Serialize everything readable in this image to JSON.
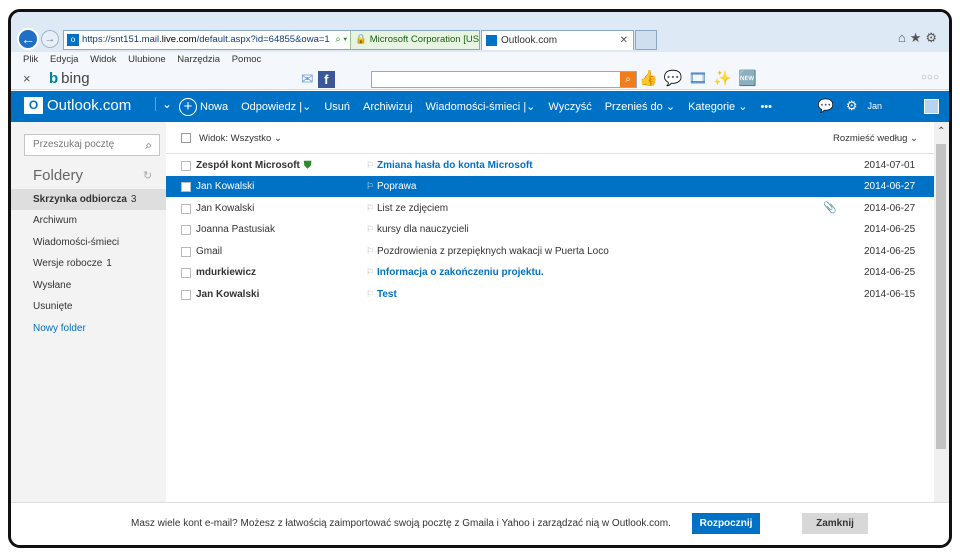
{
  "browser": {
    "url_host": "https://snt151.mail.",
    "url_domain": "live.com",
    "url_path": "/default.aspx?id=64855&owa=1",
    "security": "Microsoft Corporation [US]",
    "tab_title": "Outlook.com",
    "menu": [
      "Plik",
      "Edycja",
      "Widok",
      "Ulubione",
      "Narzędzia",
      "Pomoc"
    ],
    "toolbar_brand": "bing"
  },
  "outlook": {
    "brand": "Outlook.com",
    "commands": {
      "new": "Nowa",
      "reply": "Odpowiedz",
      "delete": "Usuń",
      "archive": "Archiwizuj",
      "junk": "Wiadomości-śmieci",
      "sweep": "Wyczyść",
      "move": "Przenieś do",
      "categories": "Kategorie",
      "more": "•••"
    },
    "user": "Jan"
  },
  "sidebar": {
    "search_placeholder": "Przeszukaj pocztę",
    "folders_heading": "Foldery",
    "folders": [
      {
        "label": "Skrzynka odbiorcza",
        "count": "3"
      },
      {
        "label": "Archiwum",
        "count": ""
      },
      {
        "label": "Wiadomości-śmieci",
        "count": ""
      },
      {
        "label": "Wersje robocze",
        "count": "1"
      },
      {
        "label": "Wysłane",
        "count": ""
      },
      {
        "label": "Usunięte",
        "count": ""
      }
    ],
    "new_folder": "Nowy folder"
  },
  "list": {
    "view_label": "Widok: Wszystko ⌄",
    "sort_label": "Rozmieść według ⌄",
    "messages": [
      {
        "from": "Zespół kont Microsoft",
        "subject": "Zmiana hasła do konta Microsoft",
        "date": "2014-07-01"
      },
      {
        "from": "Jan Kowalski",
        "subject": "Poprawa",
        "date": "2014-06-27"
      },
      {
        "from": "Jan Kowalski",
        "subject": "List ze zdjęciem",
        "date": "2014-06-27"
      },
      {
        "from": "Joanna Pastusiak",
        "subject": "kursy dla nauczycieli",
        "date": "2014-06-25"
      },
      {
        "from": "Gmail",
        "subject": "Pozdrowienia z przepięknych wakacji w Puerta Loco",
        "date": "2014-06-25"
      },
      {
        "from": "mdurkiewicz",
        "subject": "Informacja o zakończeniu projektu.",
        "date": "2014-06-25"
      },
      {
        "from": "Jan Kowalski",
        "subject": "Test",
        "date": "2014-06-15"
      }
    ]
  },
  "banner": {
    "message": "Masz wiele kont e-mail? Możesz z łatwością zaimportować swoją pocztę z Gmaila i Yahoo i zarządzać nią w Outlook.com.",
    "start": "Rozpocznij",
    "close": "Zamknij"
  },
  "colors": {
    "accent": "#0072c6",
    "selected_folder": "#dedede"
  }
}
